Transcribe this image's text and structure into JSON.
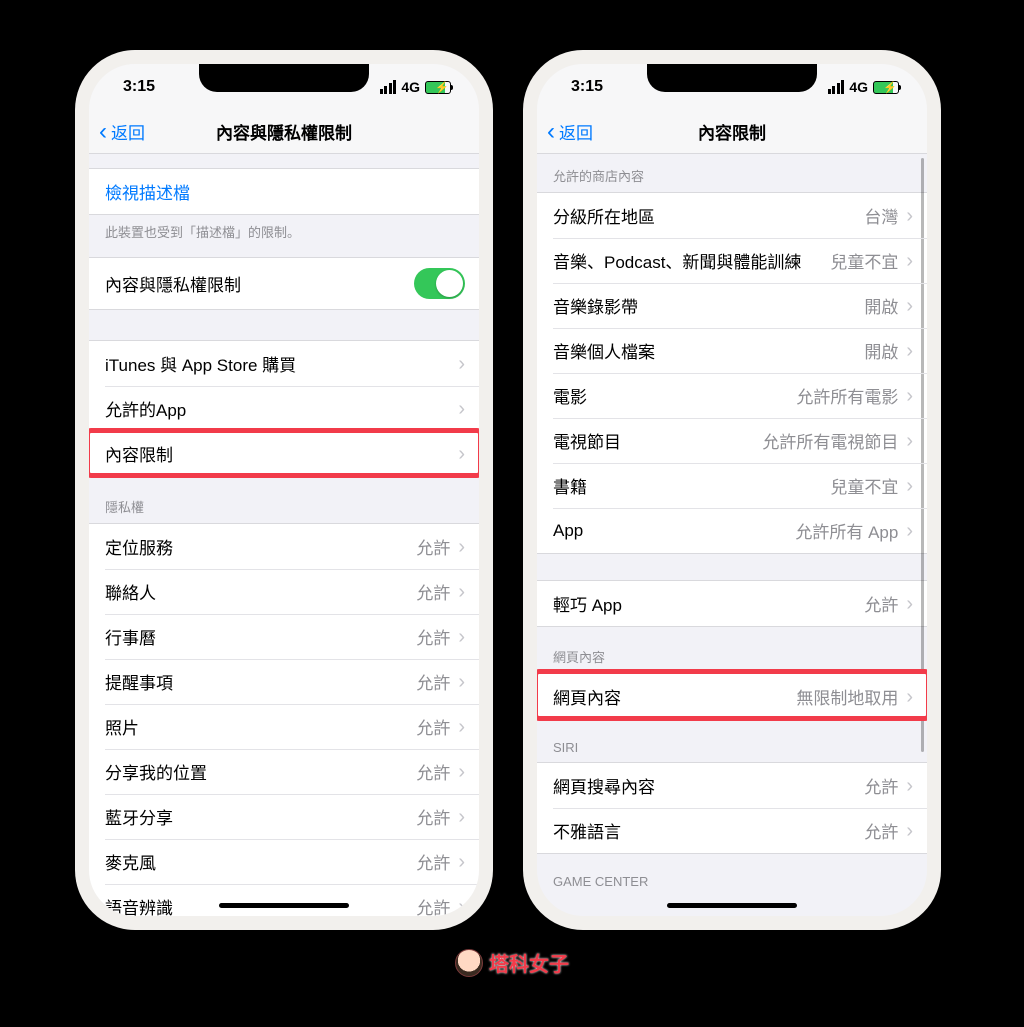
{
  "status": {
    "time": "3:15",
    "carrier": "4G"
  },
  "left": {
    "nav": {
      "back": "返回",
      "title": "內容與隱私權限制"
    },
    "profile_link": "檢視描述檔",
    "profile_footer": "此裝置也受到「描述檔」的限制。",
    "toggle_row": "內容與隱私權限制",
    "group2": [
      {
        "label": "iTunes 與 App Store 購買",
        "value": ""
      },
      {
        "label": "允許的App",
        "value": ""
      },
      {
        "label": "內容限制",
        "value": "",
        "highlight": true
      }
    ],
    "privacy_header": "隱私權",
    "privacy_rows": [
      {
        "label": "定位服務",
        "value": "允許"
      },
      {
        "label": "聯絡人",
        "value": "允許"
      },
      {
        "label": "行事曆",
        "value": "允許"
      },
      {
        "label": "提醒事項",
        "value": "允許"
      },
      {
        "label": "照片",
        "value": "允許"
      },
      {
        "label": "分享我的位置",
        "value": "允許"
      },
      {
        "label": "藍牙分享",
        "value": "允許"
      },
      {
        "label": "麥克風",
        "value": "允許"
      },
      {
        "label": "語音辨識",
        "value": "允許"
      }
    ]
  },
  "right": {
    "nav": {
      "back": "返回",
      "title": "內容限制"
    },
    "store_header": "允許的商店內容",
    "store_rows": [
      {
        "label": "分級所在地區",
        "value": "台灣"
      },
      {
        "label": "音樂、Podcast、新聞與體能訓練",
        "value": "兒童不宜"
      },
      {
        "label": "音樂錄影帶",
        "value": "開啟"
      },
      {
        "label": "音樂個人檔案",
        "value": "開啟"
      },
      {
        "label": "電影",
        "value": "允許所有電影"
      },
      {
        "label": "電視節目",
        "value": "允許所有電視節目"
      },
      {
        "label": "書籍",
        "value": "兒童不宜"
      },
      {
        "label": "App",
        "value": "允許所有 App"
      }
    ],
    "appclip_rows": [
      {
        "label": "輕巧 App",
        "value": "允許"
      }
    ],
    "web_header": "網頁內容",
    "web_rows": [
      {
        "label": "網頁內容",
        "value": "無限制地取用",
        "highlight": true
      }
    ],
    "siri_header": "SIRI",
    "siri_rows": [
      {
        "label": "網頁搜尋內容",
        "value": "允許"
      },
      {
        "label": "不雅語言",
        "value": "允許"
      }
    ],
    "gc_header": "GAME CENTER"
  },
  "watermark": "塔科女子"
}
